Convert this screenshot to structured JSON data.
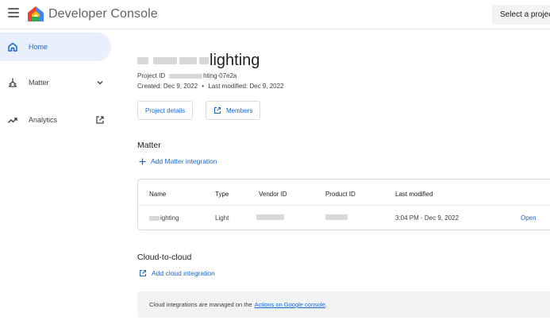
{
  "header": {
    "app_title": "Developer Console",
    "select_project_label": "Select a project"
  },
  "sidebar": {
    "items": [
      {
        "label": "Home",
        "icon": "home-icon",
        "active": true
      },
      {
        "label": "Matter",
        "icon": "matter-icon",
        "trail_icon": "chevron-down-icon"
      },
      {
        "label": "Analytics",
        "icon": "trending-up-icon",
        "trail_icon": "open-in-new-icon"
      }
    ]
  },
  "project": {
    "title_visible": "lighting",
    "id_label": "Project ID",
    "id_visible": "hting-07e2a",
    "created": "Created: Dec 9, 2022",
    "separator": "•",
    "modified": "Last modified: Dec 9, 2022",
    "details_button": "Project details",
    "members_button": "Members"
  },
  "matter": {
    "section_title": "Matter",
    "add_label": "Add Matter integration",
    "table": {
      "headers": [
        "Name",
        "Type",
        "Vendor ID",
        "Product ID",
        "Last modified"
      ],
      "rows": [
        {
          "name_visible": "ighting",
          "type": "Light",
          "last_modified": "3:04 PM - Dec 9, 2022",
          "action": "Open"
        }
      ]
    }
  },
  "cloud": {
    "section_title": "Cloud-to-cloud",
    "add_label": "Add cloud integration",
    "info_prefix": "Cloud integrations are managed on the",
    "info_link": "Actions on Google console",
    "info_suffix": "."
  },
  "colors": {
    "accent": "#1967d2",
    "active_nav_bg": "#e8f0fe",
    "info_bg": "#f1f3f4"
  }
}
